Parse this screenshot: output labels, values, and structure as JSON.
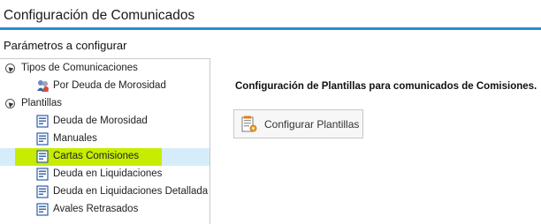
{
  "window": {
    "title": "Configuración de Comunicados",
    "accent_color": "#2a8dd4"
  },
  "sidebar": {
    "section_label": "Parámetros a configurar",
    "groups": [
      {
        "label": "Tipos de Comunicaciones",
        "icon": "collapse-arrow-icon",
        "items": [
          {
            "label": "Por Deuda de Morosidad",
            "icon": "debt-users-icon"
          }
        ]
      },
      {
        "label": "Plantillas",
        "icon": "collapse-arrow-icon",
        "items": [
          {
            "label": "Deuda de Morosidad",
            "icon": "template-document-icon"
          },
          {
            "label": "Manuales",
            "icon": "template-document-icon"
          },
          {
            "label": "Cartas Comisiones",
            "icon": "template-document-icon",
            "selected": true
          },
          {
            "label": "Deuda en Liquidaciones",
            "icon": "template-document-icon"
          },
          {
            "label": "Deuda en Liquidaciones Detallada",
            "icon": "template-document-icon"
          },
          {
            "label": "Avales Retrasados",
            "icon": "template-document-icon"
          }
        ]
      }
    ],
    "selection_color": "#c7ec00"
  },
  "main": {
    "heading": "Configuración de Plantillas para comunicados de Comisiones.",
    "configure_button": {
      "label": "Configurar Plantillas",
      "icon": "configure-templates-icon"
    }
  }
}
